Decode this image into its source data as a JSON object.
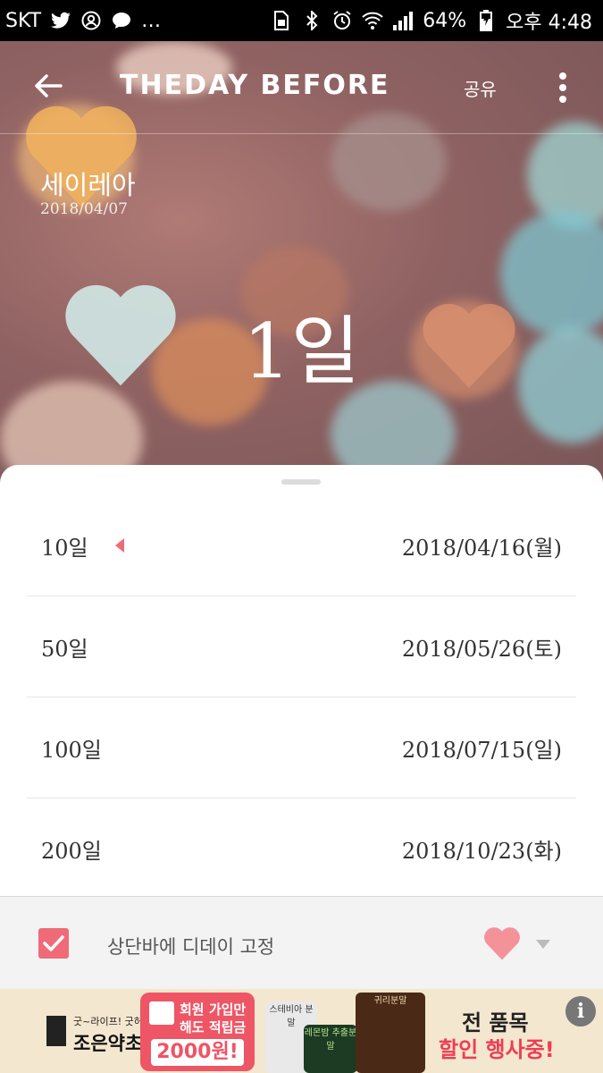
{
  "status_bar": {
    "carrier": "SKT",
    "more_indicator": "…",
    "battery_percent": "64%",
    "time": "오후 4:48",
    "icons": [
      "twitter-icon",
      "account-circle-icon",
      "chat-bubble-icon",
      "sim-icon",
      "bluetooth-icon",
      "alarm-icon",
      "wifi-icon",
      "signal-icon",
      "battery-charging-icon"
    ]
  },
  "header": {
    "logo": "THEDAY BEFORE",
    "share_label": "공유"
  },
  "event": {
    "title": "세이레아",
    "start_date": "2018/04/07",
    "count": "1일"
  },
  "milestones": [
    {
      "label": "10일",
      "date": "2018/04/16(월)",
      "is_next": true
    },
    {
      "label": "50일",
      "date": "2018/05/26(토)",
      "is_next": false
    },
    {
      "label": "100일",
      "date": "2018/07/15(일)",
      "is_next": false
    },
    {
      "label": "200일",
      "date": "2018/10/23(화)",
      "is_next": false
    }
  ],
  "pin_bar": {
    "label": "상단바에 디데이 고정",
    "checked": true
  },
  "ad": {
    "tagline": "굿~라이프! 굿허브!",
    "brand": "조은약초",
    "promo_line1": "회원 가입만",
    "promo_line2": "해도 적립금",
    "promo_amount": "2000원!",
    "product1": "스테비아 분말",
    "product2": "레몬밤 추출분말",
    "product3": "귀리분말",
    "sale_line1": "전 품목",
    "sale_line2": "할인 행사중!",
    "info": "i"
  },
  "colors": {
    "accent": "#ef6b78",
    "hero_bg": "#8f6262",
    "status_bar": "#000000"
  }
}
